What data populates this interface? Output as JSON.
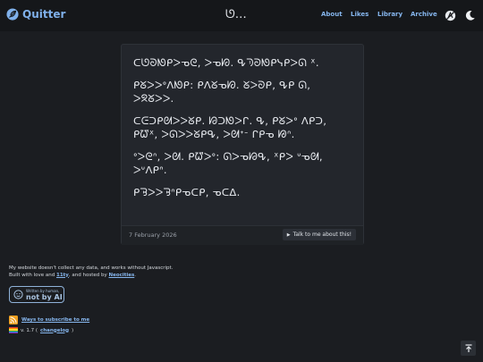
{
  "header": {
    "logo_text": "Quitter",
    "center_glyph": "ᘎ…",
    "nav": [
      "About",
      "Likes",
      "Library",
      "Archive"
    ],
    "icons": [
      "feather-icon",
      "no-ai-icon",
      "moon-icon"
    ]
  },
  "post": {
    "paragraphs": [
      "ᑕᘎᘐᘚᑭᐳᓀᘓ, ᐳᓀᘗ. ᕴᘅᘐᘚᑭᓭᑭᐳᘏ ᕽ.",
      "ᑭᘜᐳᐳᐤᐱᘚᑭ: ᑭᐱᘜᓀᘗ. ᘜᐳᘐᑭ, ᕴᑭ ᘏ, ᐳᘝᘜᐳᐳ.",
      "ᑕᕮᑐᑭᘛᐳᐳᘜᑭ. ᘙᑐᘚᐳᒋ. ᕴ, ᑭᘜᐳᐤ ᐱᑭᑐ, ᑭᘺᕽ, ᐳᘏᐳᐳᘜᑭᕴ, ᐳᘛᐩᐨ ᒋᑭᓀ ᘘᐢ.",
      "ᐤᐳᘓᐢ, ᐳᘛ. ᑭᘺᐳᐤ: ᘏᐳᓀᘙᕴ, ᕽᑭᐳ ᐡᓀᘛ, ᐳᐡᐱᑭᐢ.",
      "ᑭᘋᐳᐳᘋᐢᑭᓀᑕᑭ, ᓀᑕᐃ."
    ],
    "date": "7 February 2026",
    "talk_label": "Talk to me about this!"
  },
  "footer": {
    "line1": "My website doesn't collect any data, and works without Javascript.",
    "line2_prefix": "Built with love and",
    "eleventy": "11ty",
    "line2_mid": ", and hosted by",
    "neocities": "Neocities",
    "line2_suffix": ".",
    "badge_small": "Written by human,",
    "badge_big": "not by AI",
    "rss_link": "Ways to subscribe to me",
    "version_prefix": "v. 1.7 (",
    "version_link": "changelog",
    "version_suffix": ")"
  },
  "colors": {
    "background": "#1b1d21",
    "header": "#15171a",
    "card": "#23262c",
    "link": "#86b6ee",
    "rss": "#f0a020"
  }
}
